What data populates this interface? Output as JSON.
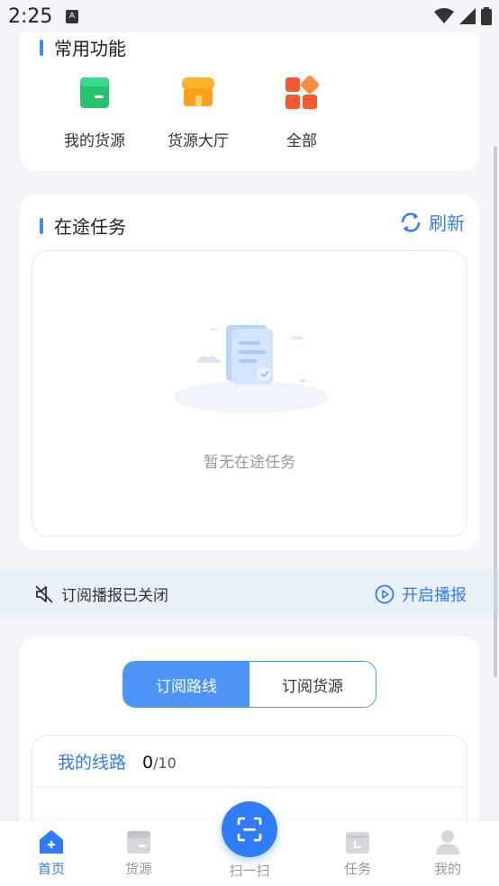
{
  "status_bar": {
    "time": "2:25",
    "notif_glyph": "A"
  },
  "common_functions": {
    "title": "常用功能",
    "items": [
      {
        "label": "我的货源",
        "icon": "my-cargo-icon",
        "color": "#25c26e"
      },
      {
        "label": "货源大厅",
        "icon": "cargo-hall-icon",
        "color": "#ff9f1a"
      },
      {
        "label": "全部",
        "icon": "all-apps-icon",
        "color": "#f4582e"
      }
    ]
  },
  "in_transit": {
    "title": "在途任务",
    "refresh_label": "刷新",
    "empty_text": "暂无在途任务"
  },
  "broadcast": {
    "status_text": "订阅播报已关闭",
    "action_label": "开启播报"
  },
  "subscription": {
    "tabs": [
      {
        "label": "订阅路线",
        "active": true
      },
      {
        "label": "订阅货源",
        "active": false
      }
    ],
    "routes_label": "我的线路",
    "routes_count": "0",
    "routes_max": "/10"
  },
  "tabbar": {
    "items": [
      {
        "label": "首页",
        "icon": "home-icon",
        "active": true
      },
      {
        "label": "货源",
        "icon": "cargo-icon",
        "active": false
      },
      {
        "label": "扫一扫",
        "icon": "scan-icon",
        "active": false
      },
      {
        "label": "任务",
        "icon": "task-icon",
        "active": false
      },
      {
        "label": "我的",
        "icon": "profile-icon",
        "active": false
      }
    ]
  },
  "colors": {
    "accent": "#2f7cf6",
    "background": "#f3f5f8",
    "muted_text": "#999999"
  }
}
